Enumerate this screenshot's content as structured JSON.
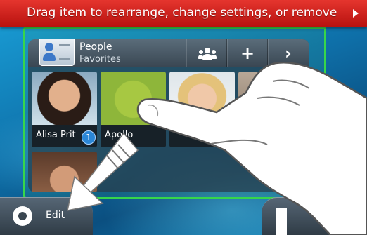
{
  "banner": {
    "text": "Drag item to rearrange, change settings, or remove",
    "arrow_icon": "triangle-right-icon"
  },
  "widget": {
    "title": "People",
    "subtitle": "Favorites",
    "buttons": [
      {
        "icon": "group-icon"
      },
      {
        "icon": "plus-icon",
        "glyph": "+"
      },
      {
        "icon": "chevron-right-icon",
        "glyph": "›"
      }
    ],
    "contacts": [
      {
        "name": "Alisa Prit",
        "badge": "1"
      },
      {
        "name": "Apollo"
      },
      {
        "name": ""
      },
      {
        "name": ""
      }
    ]
  },
  "bottom": {
    "edit_label": "Edit",
    "edit_icon": "gear-icon",
    "trash_icon": "trash-icon"
  },
  "colors": {
    "banner": "#c8201c",
    "frame": "#37d64a",
    "accent": "#2a86d6"
  }
}
